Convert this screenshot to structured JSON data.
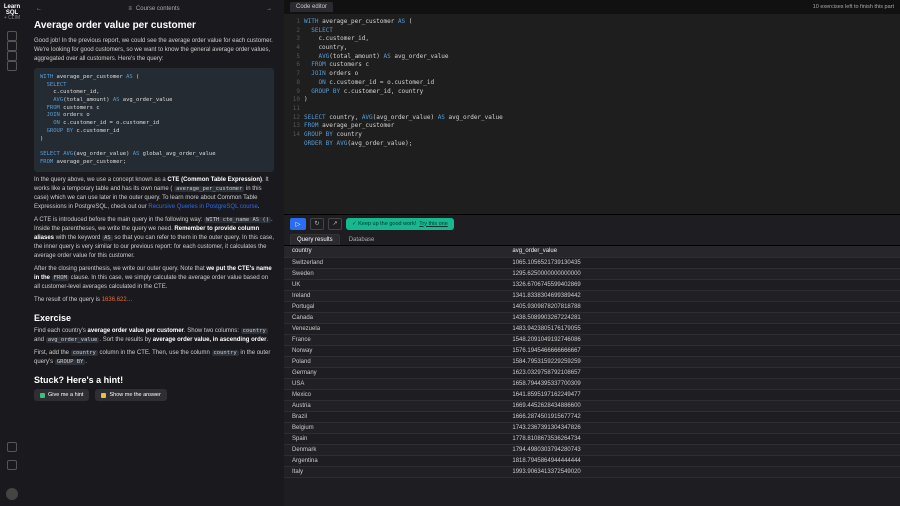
{
  "brand": {
    "line1": "Learn",
    "line2": "SQL",
    "sub": "+ CLIM"
  },
  "rail_icons": [
    "home-icon",
    "message-icon",
    "bookmark-icon",
    "file-icon"
  ],
  "rail_bottom": [
    "gear-icon",
    "help-icon"
  ],
  "lesson": {
    "back_glyph": "←",
    "fwd_glyph": "→",
    "contents_label": "Course contents",
    "title": "Average order value per customer",
    "intro": "Good job! In the previous report, we could see the average order value for each customer. We're looking for good customers, so we want to know the general average order values, aggregated over all customers. Here's the query:",
    "code1": "WITH average_per_customer AS (\n  SELECT\n    c.customer_id,\n    AVG(total_amount) AS avg_order_value\n  FROM customers c\n  JOIN orders o\n    ON c.customer_id = o.customer_id\n  GROUP BY c.customer_id\n)\n\nSELECT AVG(avg_order_value) AS global_avg_order_value\nFROM average_per_customer;",
    "p2_pre": "In the query above, we use a concept known as a ",
    "p2_strong": "CTE (Common Table Expression)",
    "p2_mid": ". It works like a temporary table and has its own name ( ",
    "p2_code": "average_per_customer",
    "p2_post": " in this case) which we can use later in the outer query. To learn more about Common Table Expressions in PostgreSQL, check out our ",
    "p2_link": "Recursive Queries in PostgreSQL course",
    "p3": "A CTE is introduced before the main query in the following way:",
    "p3_code": "WITH cte_name AS ()",
    "p3_post": ". Inside the parentheses, we write the query we need. ",
    "p3_strong": "Remember to provide column aliases",
    "p3_post2": " with the keyword ",
    "p3_code2": "AS",
    "p3_post3": " so that you can refer to them in the outer query. In this case, the inner query is very similar to our previous report: for each customer, it calculates the average order value for this customer.",
    "p4_pre": "After the closing parenthesis, we write our outer query. Note that ",
    "p4_strong": "we put the CTE's name in the ",
    "p4_code": "FROM",
    "p4_post": " clause. In this case, we simply calculate the average order value based on all customer-level averages calculated in the CTE.",
    "p5_pre": "The result of the query is ",
    "p5_num": "1636.622…",
    "ex_heading": "Exercise",
    "ex_p1_pre": "Find each country's ",
    "ex_p1_strong": "average order value per customer",
    "ex_p1_mid": ". Show two columns: ",
    "ex_p1_c1": "country",
    "ex_p1_and": " and ",
    "ex_p1_c2": "avg_order_value",
    "ex_p1_post": ". Sort the results by ",
    "ex_p1_strong2": "average order value, in ascending order",
    "ex_p2_pre": "First, add the ",
    "ex_p2_c1": "country",
    "ex_p2_mid": " column in the CTE. Then, use the column ",
    "ex_p2_c2": "country",
    "ex_p2_post": " in the outer query's ",
    "ex_p2_c3": "GROUP BY",
    "hint_heading": "Stuck? Here's a hint!",
    "hint_btn1": "Give me a hint",
    "hint_btn2": "Show me the answer"
  },
  "topbar": {
    "tab": "Code editor",
    "status": "10 exercises left to finish this part"
  },
  "editor": {
    "gutter": [
      "1",
      "2",
      "3",
      "4",
      "5",
      "6",
      "7",
      "8",
      "9",
      "10",
      "11",
      "12",
      "13",
      "14"
    ],
    "line1": "WITH average_per_customer AS (",
    "line2": "  SELECT",
    "line3": "    c.customer_id,",
    "line4": "    country,",
    "line5": "    AVG(total_amount) AS avg_order_value",
    "line6": "  FROM customers c",
    "line7": "  JOIN orders o",
    "line8": "    ON c.customer_id = o.customer_id",
    "line9": "  GROUP BY c.customer_id, country",
    "line10": ")",
    "line11": "",
    "line12": "SELECT country, AVG(avg_order_value) AS avg_order_value",
    "line13": "FROM average_per_customer",
    "line14_a": "GROUP BY country",
    "line14_b": "ORDER BY AVG(avg_order_value);"
  },
  "runbar": {
    "play_glyph": "▷",
    "reset_glyph": "↻",
    "share_glyph": "↗",
    "feedback_pre": "✓ Keep up the good work! ",
    "feedback_link": "Try this one"
  },
  "result_tabs": {
    "tab1": "Query results",
    "tab2": "Database"
  },
  "table": {
    "headers": [
      "country",
      "avg_order_value"
    ],
    "rows": [
      [
        "Switzerland",
        "1065.1056521739130435"
      ],
      [
        "Sweden",
        "1295.6250000000000000"
      ],
      [
        "UK",
        "1326.6706745599402869"
      ],
      [
        "Ireland",
        "1341.8338304699389442"
      ],
      [
        "Portugal",
        "1405.9309878207818788"
      ],
      [
        "Canada",
        "1438.5089903267224281"
      ],
      [
        "Venezuela",
        "1483.9423805176179055"
      ],
      [
        "France",
        "1548.2091049192746086"
      ],
      [
        "Norway",
        "1576.1945466666666667"
      ],
      [
        "Poland",
        "1584.7953159229259259"
      ],
      [
        "Germany",
        "1623.0329758792108657"
      ],
      [
        "USA",
        "1658.7944395337700309"
      ],
      [
        "Mexico",
        "1641.8595197162249477"
      ],
      [
        "Austria",
        "1669.4452628434886600"
      ],
      [
        "Brazil",
        "1666.2874501915677742"
      ],
      [
        "Belgium",
        "1743.2367391304347826"
      ],
      [
        "Spain",
        "1778.8108673536264734"
      ],
      [
        "Denmark",
        "1794.4980303794280743"
      ],
      [
        "Argentina",
        "1818.7945864944444444"
      ],
      [
        "Italy",
        "1993.9063413372549020"
      ]
    ]
  }
}
